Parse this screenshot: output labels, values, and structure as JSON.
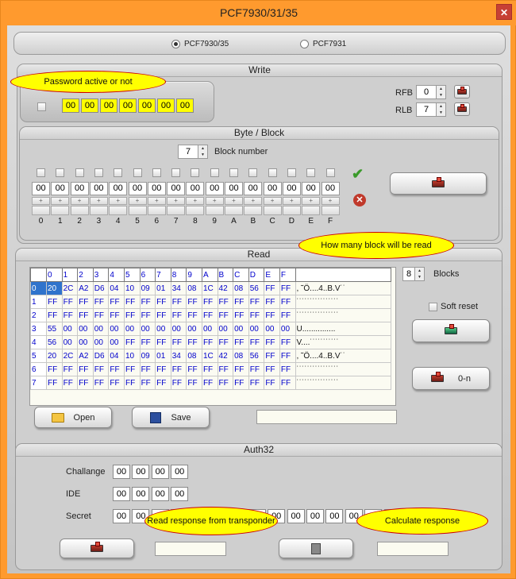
{
  "window": {
    "title": "PCF7930/31/35",
    "close_glyph": "✕"
  },
  "chip_select": {
    "options": [
      {
        "label": "PCF7930/35",
        "selected": true
      },
      {
        "label": "PCF7931",
        "selected": false
      }
    ]
  },
  "write": {
    "title": "Write",
    "password_bytes": [
      "00",
      "00",
      "00",
      "00",
      "00",
      "00",
      "00"
    ],
    "rfb_label": "RFB",
    "rfb_value": "0",
    "rlb_label": "RLB",
    "rlb_value": "7",
    "bubble_password": "Password active or not"
  },
  "byte_block": {
    "title": "Byte / Block",
    "block_number_value": "7",
    "block_number_label": "Block number",
    "bytes": [
      "00",
      "00",
      "00",
      "00",
      "00",
      "00",
      "00",
      "00",
      "00",
      "00",
      "00",
      "00",
      "00",
      "00",
      "00",
      "00"
    ],
    "plus_glyph": "+",
    "hex_labels": [
      "0",
      "1",
      "2",
      "3",
      "4",
      "5",
      "6",
      "7",
      "8",
      "9",
      "A",
      "B",
      "C",
      "D",
      "E",
      "F"
    ]
  },
  "read": {
    "title": "Read",
    "blocks_value": "8",
    "blocks_label": "Blocks",
    "soft_reset_label": "Soft reset",
    "btn_0n_label": "0-n",
    "open_label": "Open",
    "save_label": "Save",
    "bubble_blocks": "How many block will be read",
    "col_headers": [
      "0",
      "1",
      "2",
      "3",
      "4",
      "5",
      "6",
      "7",
      "8",
      "9",
      "A",
      "B",
      "C",
      "D",
      "E",
      "F"
    ],
    "rows": [
      {
        "id": "0",
        "bytes": [
          "20",
          "2C",
          "A2",
          "D6",
          "04",
          "10",
          "09",
          "01",
          "34",
          "08",
          "1C",
          "42",
          "08",
          "56",
          "FF",
          "FF"
        ],
        "ascii": ", ˜Ö....4..B.V˙˙"
      },
      {
        "id": "1",
        "bytes": [
          "FF",
          "FF",
          "FF",
          "FF",
          "FF",
          "FF",
          "FF",
          "FF",
          "FF",
          "FF",
          "FF",
          "FF",
          "FF",
          "FF",
          "FF",
          "FF"
        ],
        "ascii": "˙˙˙˙˙˙˙˙˙˙˙˙˙˙˙˙"
      },
      {
        "id": "2",
        "bytes": [
          "FF",
          "FF",
          "FF",
          "FF",
          "FF",
          "FF",
          "FF",
          "FF",
          "FF",
          "FF",
          "FF",
          "FF",
          "FF",
          "FF",
          "FF",
          "FF"
        ],
        "ascii": "˙˙˙˙˙˙˙˙˙˙˙˙˙˙˙˙"
      },
      {
        "id": "3",
        "bytes": [
          "55",
          "00",
          "00",
          "00",
          "00",
          "00",
          "00",
          "00",
          "00",
          "00",
          "00",
          "00",
          "00",
          "00",
          "00",
          "00"
        ],
        "ascii": "U..............."
      },
      {
        "id": "4",
        "bytes": [
          "56",
          "00",
          "00",
          "00",
          "00",
          "FF",
          "FF",
          "FF",
          "FF",
          "FF",
          "FF",
          "FF",
          "FF",
          "FF",
          "FF",
          "FF"
        ],
        "ascii": "V....˙˙˙˙˙˙˙˙˙˙˙"
      },
      {
        "id": "5",
        "bytes": [
          "20",
          "2C",
          "A2",
          "D6",
          "04",
          "10",
          "09",
          "01",
          "34",
          "08",
          "1C",
          "42",
          "08",
          "56",
          "FF",
          "FF"
        ],
        "ascii": ", ˜Ö....4..B.V˙˙"
      },
      {
        "id": "6",
        "bytes": [
          "FF",
          "FF",
          "FF",
          "FF",
          "FF",
          "FF",
          "FF",
          "FF",
          "FF",
          "FF",
          "FF",
          "FF",
          "FF",
          "FF",
          "FF",
          "FF"
        ],
        "ascii": "˙˙˙˙˙˙˙˙˙˙˙˙˙˙˙˙"
      },
      {
        "id": "7",
        "bytes": [
          "FF",
          "FF",
          "FF",
          "FF",
          "FF",
          "FF",
          "FF",
          "FF",
          "FF",
          "FF",
          "FF",
          "FF",
          "FF",
          "FF",
          "FF",
          "FF"
        ],
        "ascii": "˙˙˙˙˙˙˙˙˙˙˙˙˙˙˙˙"
      }
    ]
  },
  "auth32": {
    "title": "Auth32",
    "challange_label": "Challange",
    "challange": [
      "00",
      "00",
      "00",
      "00"
    ],
    "ide_label": "IDE",
    "ide": [
      "00",
      "00",
      "00",
      "00"
    ],
    "secret_label": "Secret",
    "secret": [
      "00",
      "00",
      "00",
      "00",
      "00",
      "00",
      "00",
      "00",
      "00",
      "00",
      "00",
      "00",
      "00",
      "00",
      "00",
      "00"
    ],
    "bubble_read": "Read response from transponder",
    "bubble_calc": "Calculate response"
  },
  "colors": {
    "title_bar": "#ff9a2e",
    "highlight": "#ffff00",
    "selection": "#2f73cc",
    "hex_text": "#0000cc"
  }
}
